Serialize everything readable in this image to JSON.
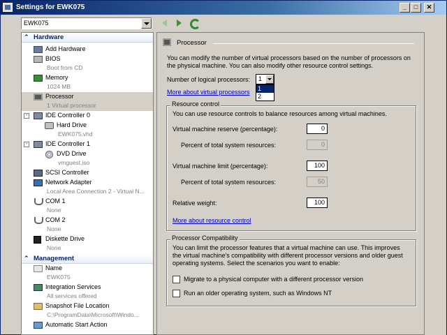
{
  "window": {
    "title": "Settings for EWK075"
  },
  "toolbar": {
    "vm_selected": "EWK075"
  },
  "tree": {
    "hardware_header": "Hardware",
    "management_header": "Management",
    "items": [
      {
        "name": "Add Hardware",
        "sub": ""
      },
      {
        "name": "BIOS",
        "sub": "Boot from CD"
      },
      {
        "name": "Memory",
        "sub": "1024 MB"
      },
      {
        "name": "Processor",
        "sub": "1 Virtual processor"
      },
      {
        "name": "IDE Controller 0",
        "sub": ""
      },
      {
        "name": "Hard Drive",
        "sub": "EWK075.vhd"
      },
      {
        "name": "IDE Controller 1",
        "sub": ""
      },
      {
        "name": "DVD Drive",
        "sub": "vmguest.iso"
      },
      {
        "name": "SCSI Controller",
        "sub": ""
      },
      {
        "name": "Network Adapter",
        "sub": "Local Area Connection 2 - Virtual N..."
      },
      {
        "name": "COM 1",
        "sub": "None"
      },
      {
        "name": "COM 2",
        "sub": "None"
      },
      {
        "name": "Diskette Drive",
        "sub": "None"
      }
    ],
    "mgmt_items": [
      {
        "name": "Name",
        "sub": "EWK075"
      },
      {
        "name": "Integration Services",
        "sub": "All services offered"
      },
      {
        "name": "Snapshot File Location",
        "sub": "C:\\ProgramData\\Microsoft\\Windo..."
      },
      {
        "name": "Automatic Start Action",
        "sub": ""
      }
    ]
  },
  "panel": {
    "title": "Processor",
    "intro_line1": "You can modify the number of virtual processors based on the number of processors on",
    "intro_line2": "the physical machine. You can also modify other resource control settings.",
    "num_proc_label": "Number of logical processors:",
    "num_proc_value": "1",
    "num_proc_options": [
      "1",
      "2"
    ],
    "more_vp_link": "More about virtual processors",
    "resource": {
      "title": "Resource control",
      "desc": "You can use resource controls to balance resources among virtual machines.",
      "reserve_label": "Virtual machine reserve (percentage):",
      "reserve_value": "0",
      "reserve_pct_label": "Percent of total system resources:",
      "reserve_pct_value": "0",
      "limit_label": "Virtual machine limit (percentage):",
      "limit_value": "100",
      "limit_pct_label": "Percent of total system resources:",
      "limit_pct_value": "50",
      "weight_label": "Relative weight:",
      "weight_value": "100",
      "more_link": "More about resource control"
    },
    "compat": {
      "title": "Processor Compatibility",
      "desc1": "You can limit the processor features that a virtual machine can use. This improves",
      "desc2": "the virtual machine's compatibility with different processor versions and older guest",
      "desc3": "operating systems. Select the scenarios you want to enable:",
      "migrate_label": "Migrate to a physical computer with a different processor version",
      "older_os_label": "Run an older operating system, such as Windows NT"
    }
  }
}
